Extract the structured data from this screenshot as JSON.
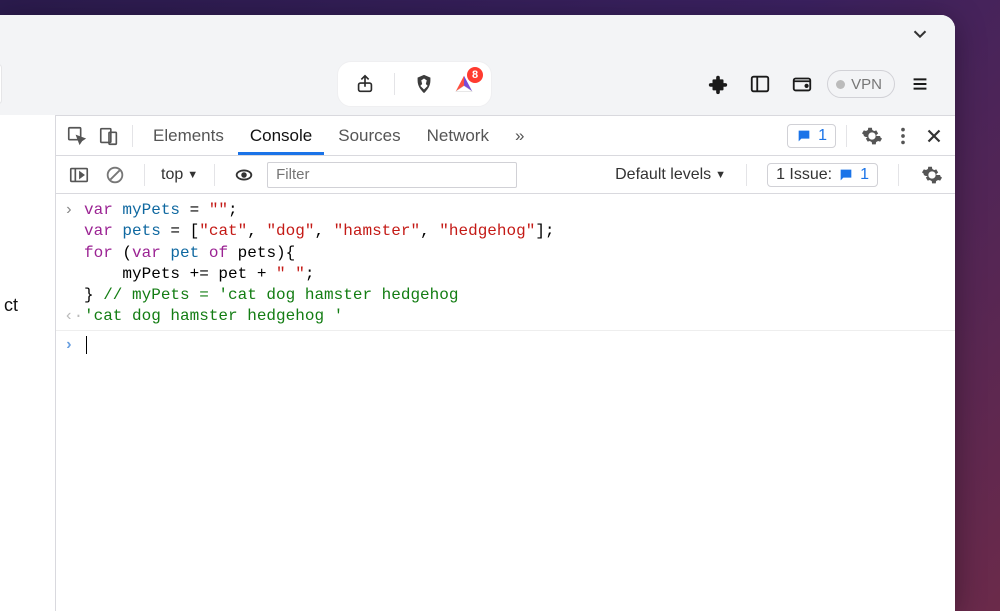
{
  "titlebar": {},
  "toolbar": {
    "brave_badge_count": "8",
    "vpn_label": "VPN"
  },
  "left_pane": {
    "fragment": "ct"
  },
  "devtools": {
    "tabs": {
      "elements": "Elements",
      "console": "Console",
      "sources": "Sources",
      "network": "Network",
      "overflow": "»"
    },
    "messages_count": "1",
    "filterbar": {
      "context": "top",
      "filter_placeholder": "Filter",
      "levels": "Default levels",
      "issues_label": "1 Issue:",
      "issues_count": "1"
    },
    "console": {
      "code_line1_kw1": "var",
      "code_line1_var": " myPets ",
      "code_line1_eq": "= ",
      "code_line1_str": "\"\"",
      "code_line1_end": ";",
      "code_line2_kw1": "var",
      "code_line2_var": " pets ",
      "code_line2_eq": "= [",
      "code_line2_s1": "\"cat\"",
      "code_line2_c1": ", ",
      "code_line2_s2": "\"dog\"",
      "code_line2_c2": ", ",
      "code_line2_s3": "\"hamster\"",
      "code_line2_c3": ", ",
      "code_line2_s4": "\"hedgehog\"",
      "code_line2_end": "];",
      "code_line3_kw1": "for",
      "code_line3_a": " (",
      "code_line3_kw2": "var",
      "code_line3_var": " pet ",
      "code_line3_kw3": "of",
      "code_line3_b": " pets){",
      "code_line4": "    myPets += pet + ",
      "code_line4_str": "\" \"",
      "code_line4_end": ";",
      "code_line5_a": "} ",
      "code_line5_comment": "// myPets = 'cat dog hamster hedgehog",
      "result": "'cat dog hamster hedgehog '"
    }
  }
}
